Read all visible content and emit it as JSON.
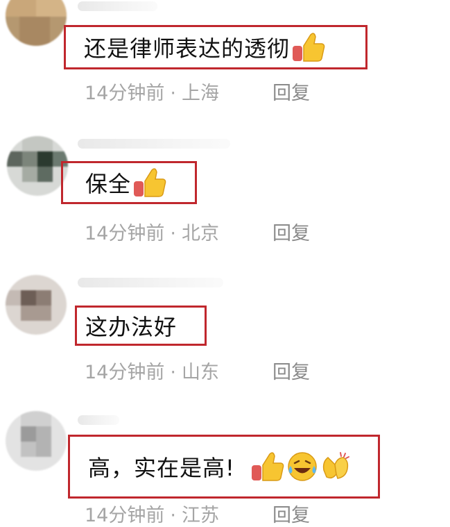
{
  "comments": [
    {
      "text": "还是律师表达的透彻",
      "time": "14分钟前",
      "location": "上海",
      "reply_label": "回复",
      "emojis": [
        "thumbs-up"
      ]
    },
    {
      "text": "保全",
      "time": "14分钟前",
      "location": "北京",
      "reply_label": "回复",
      "emojis": [
        "thumbs-up"
      ]
    },
    {
      "text": "这办法好",
      "time": "14分钟前",
      "location": "山东",
      "reply_label": "回复",
      "emojis": []
    },
    {
      "text": "高，实在是高!",
      "time": "14分钟前",
      "location": "江苏",
      "reply_label": "回复",
      "emojis": [
        "thumbs-up",
        "laughing-tears",
        "clapping-hands"
      ]
    }
  ],
  "separator": "·",
  "colors": {
    "highlight_border": "#c0272d",
    "comment_text": "#111111",
    "meta_text": "#a5a5a5",
    "reply_text": "#8a8a8a"
  }
}
